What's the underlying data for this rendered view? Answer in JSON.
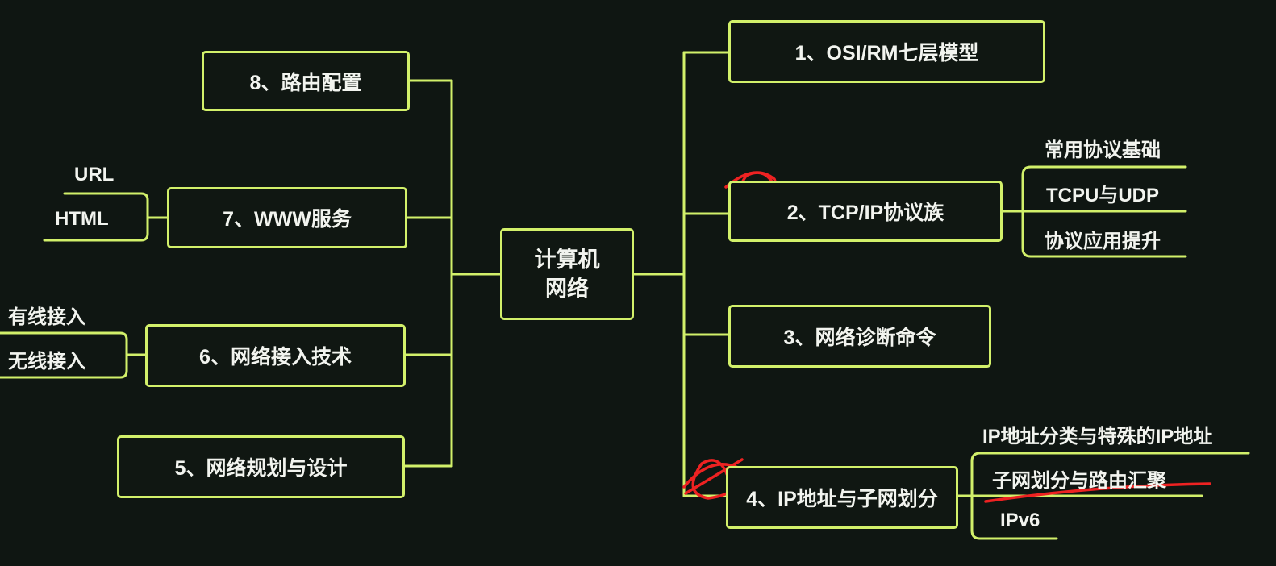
{
  "center": {
    "line1": "计算机",
    "line2": "网络"
  },
  "branches": {
    "b1": "1、OSI/RM七层模型",
    "b2": "2、TCP/IP协议族",
    "b3": "3、网络诊断命令",
    "b4": "4、IP地址与子网划分",
    "b5": "5、网络规划与设计",
    "b6": "6、网络接入技术",
    "b7": "7、WWW服务",
    "b8": "8、路由配置"
  },
  "subs": {
    "b2": [
      "常用协议基础",
      "TCPU与UDP",
      "协议应用提升"
    ],
    "b4": [
      "IP地址分类与特殊的IP地址",
      "子网划分与路由汇聚",
      "IPv6"
    ],
    "b6": [
      "有线接入",
      "无线接入"
    ],
    "b7": [
      "URL",
      "HTML"
    ]
  },
  "colors": {
    "line": "#d2f06a",
    "annotation": "#ee2222",
    "background": "#0f1612",
    "text": "#f2f4ef"
  }
}
